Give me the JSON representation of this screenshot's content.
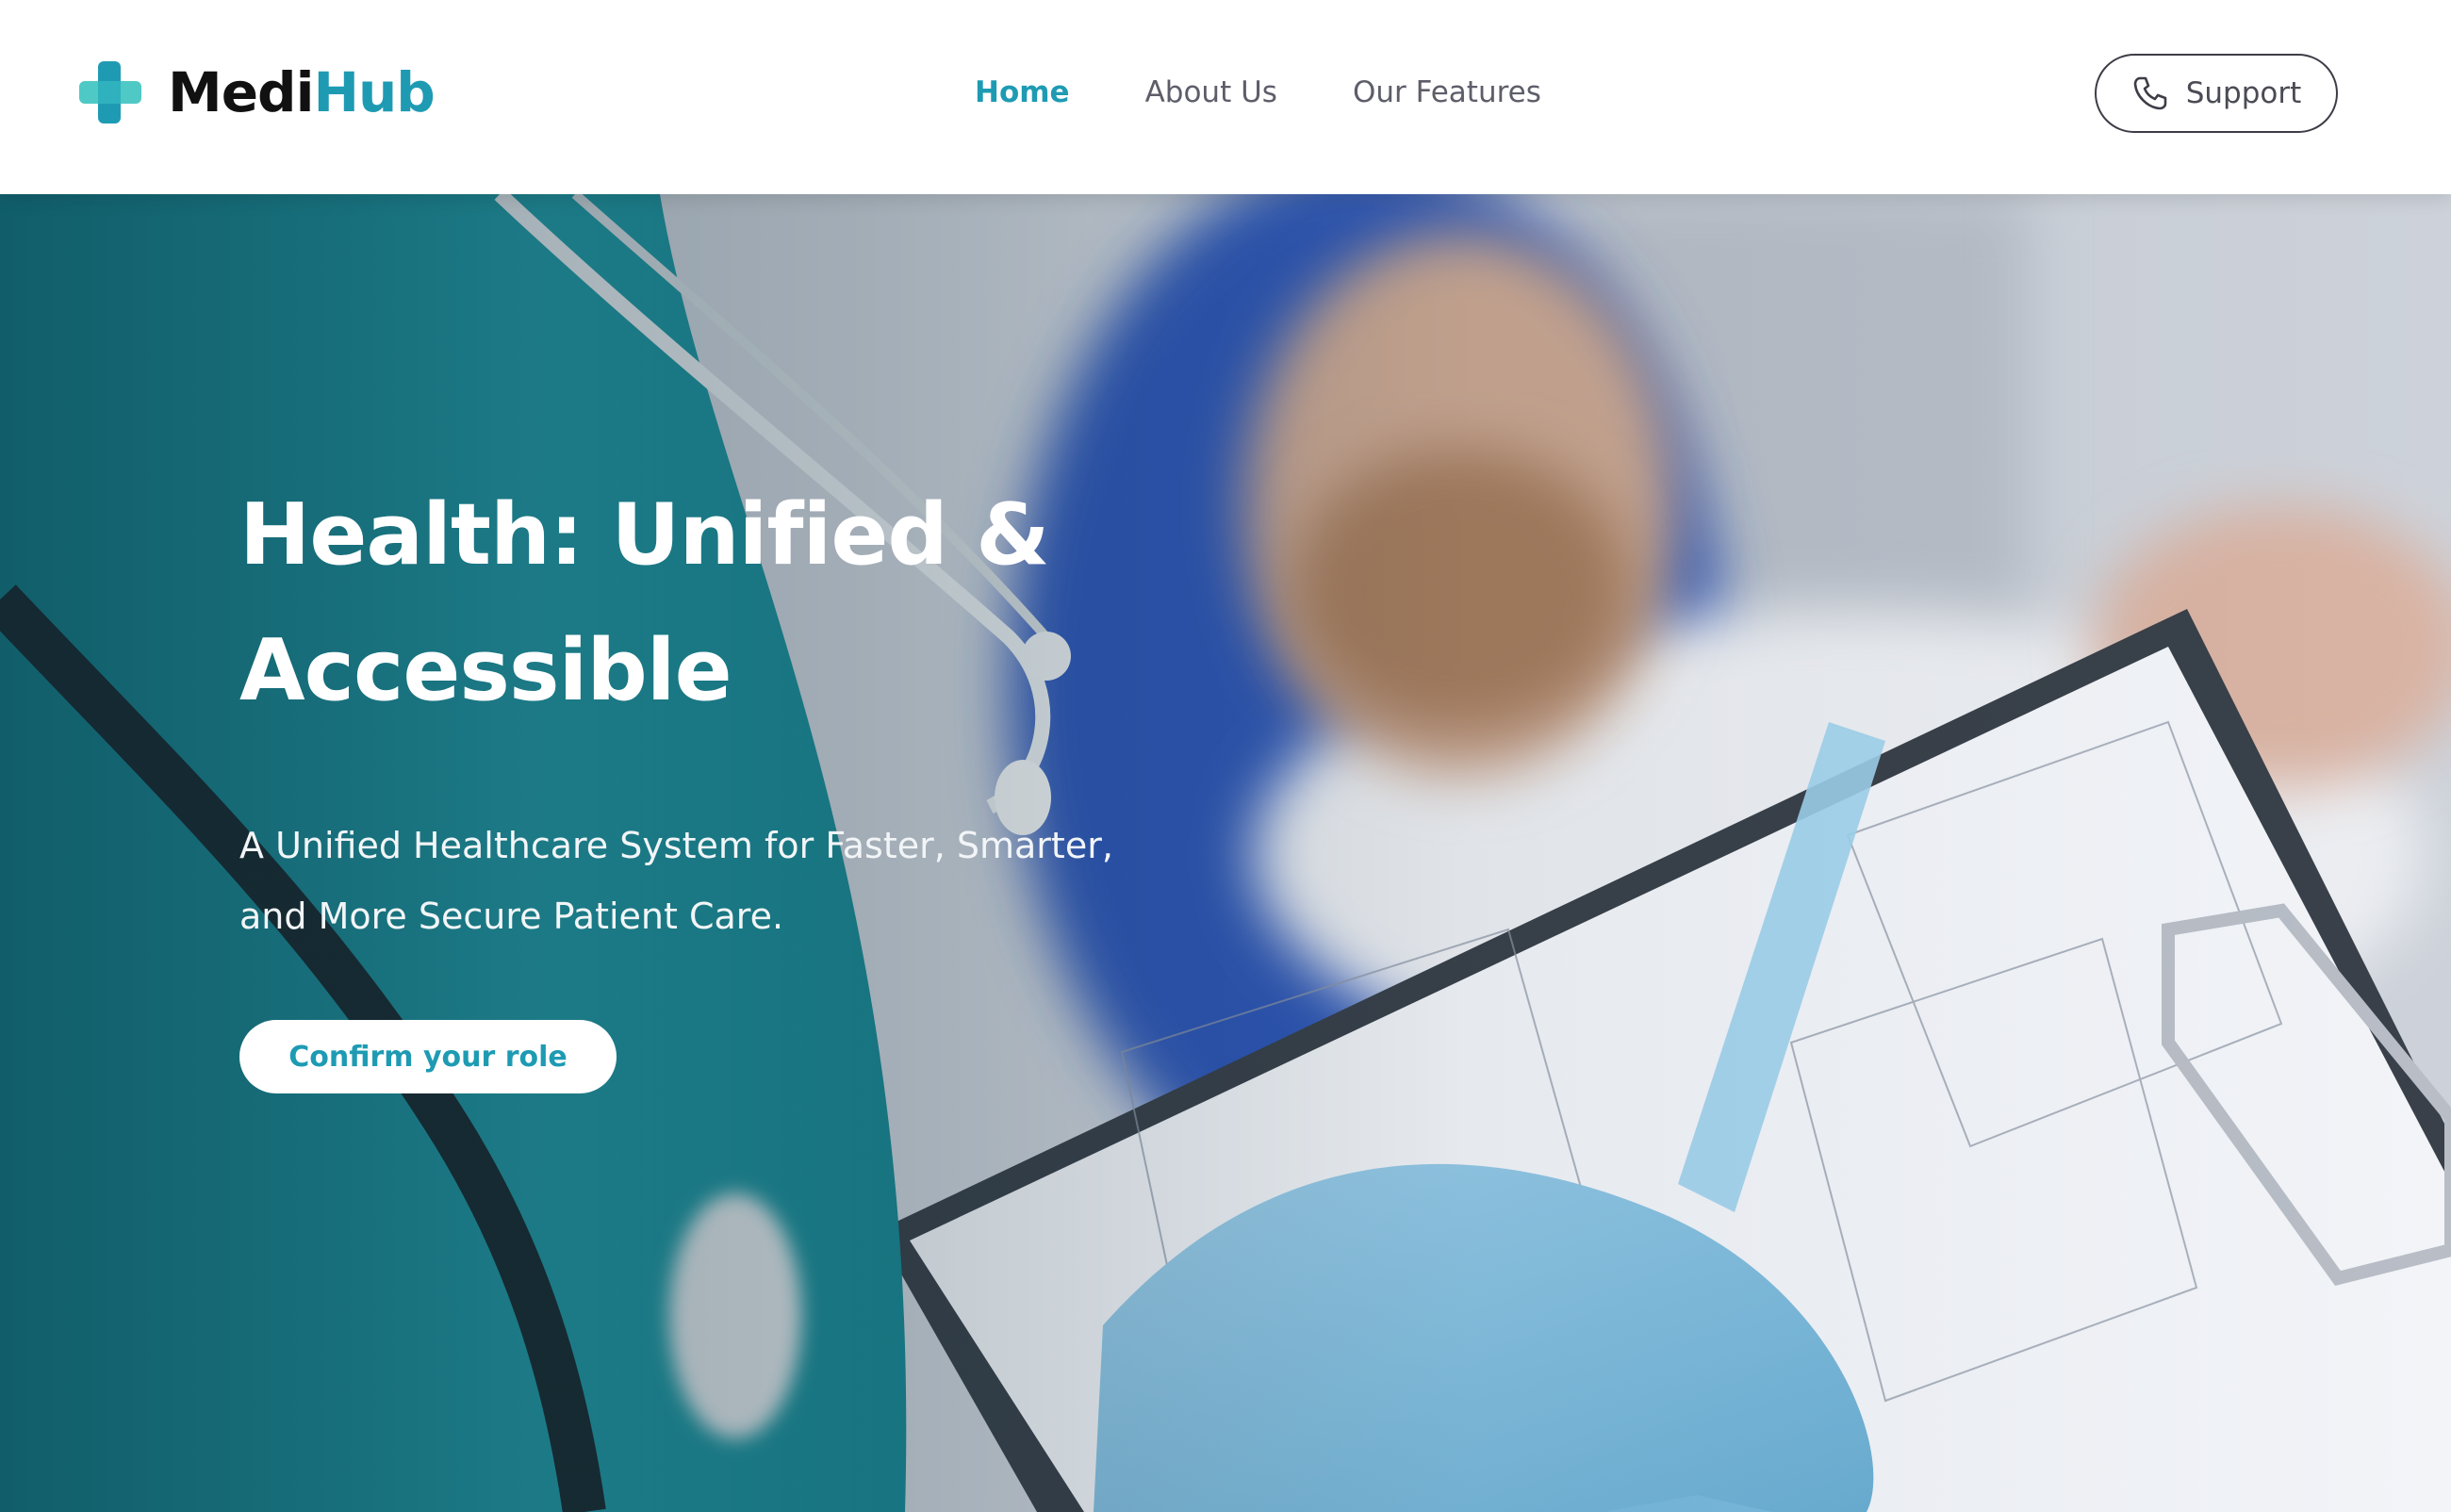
{
  "brand": {
    "name_primary": "Medi",
    "name_accent": "Hub",
    "logo_icon": "medical-cross-icon"
  },
  "nav": {
    "links": [
      {
        "label": "Home",
        "active": true
      },
      {
        "label": "About Us",
        "active": false
      },
      {
        "label": "Our Features",
        "active": false
      }
    ]
  },
  "support": {
    "label": "Support",
    "icon": "phone-icon"
  },
  "hero": {
    "title_line1": "Health: Unified &",
    "title_line2": "Accessible",
    "subtitle": "A Unified Healthcare System for Faster, Smarter, and More Secure Patient Care.",
    "cta_label": "Confirm your role"
  },
  "colors": {
    "accent": "#1e9bb3",
    "nav_text": "#5e5e6a",
    "brand_dark": "#111111",
    "hero_teal": "#2b9aa3"
  }
}
